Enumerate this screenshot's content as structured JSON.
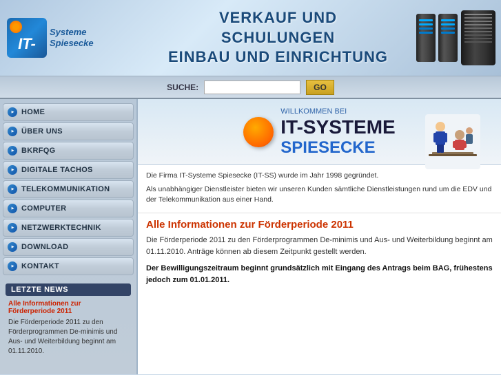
{
  "header": {
    "logo_it": "IT-",
    "logo_systeme": "Systeme",
    "logo_spiesecke": "Spiesecke",
    "tagline_line1": "VERKAUF UND SCHULUNGEN",
    "tagline_line2": "EINBAU UND EINRICHTUNG"
  },
  "search": {
    "label": "SUCHE:",
    "placeholder": "",
    "go_button": "GO"
  },
  "nav": {
    "items": [
      {
        "label": "HOME",
        "id": "home"
      },
      {
        "label": "ÜBER UNS",
        "id": "ueber-uns"
      },
      {
        "label": "BKrFQG",
        "id": "bkrfqg"
      },
      {
        "label": "DIGITALE TACHOS",
        "id": "digitale-tachos"
      },
      {
        "label": "TELEKOMMUNIKATION",
        "id": "telekommunikation"
      },
      {
        "label": "COMPUTER",
        "id": "computer"
      },
      {
        "label": "NETZWERKTECHNIK",
        "id": "netzwerktechnik"
      },
      {
        "label": "DOWNLOAD",
        "id": "download"
      },
      {
        "label": "KONTAKT",
        "id": "kontakt"
      }
    ]
  },
  "sidebar_news": {
    "header": "LETZTE NEWS",
    "link_text": "Alle Informationen zur Förderperiode 2011",
    "body_text": "Die Förderperiode 2011 zu den Förderprogrammen De-minimis und Aus- und Weiterbildung beginnt am 01.11.2010."
  },
  "welcome": {
    "small_text": "WILLKOMMEN BEI",
    "title": "IT-SYSTEME",
    "subtitle": "SPIESECKE"
  },
  "intro": {
    "para1": "Die Firma IT-Systeme Spiesecke (IT-SS) wurde im Jahr 1998 gegründet.",
    "para2": "Als unabhängiger Dienstleister bieten wir unseren Kunden sämtliche Dienstleistungen rund um die EDV und der Telekommunikation aus einer Hand."
  },
  "news_main": {
    "title": "Alle Informationen zur Förderperiode 2011",
    "body": "Die Förderperiode 2011 zu den Förderprogrammen De-minimis und Aus- und Weiterbildung beginnt am 01.11.2010. Anträge können ab diesem Zeitpunkt gestellt werden.",
    "bold_text": "Der Bewilligungszeitraum beginnt grundsätzlich mit Eingang des Antrags beim BAG, frühestens jedoch zum 01.01.2011."
  }
}
